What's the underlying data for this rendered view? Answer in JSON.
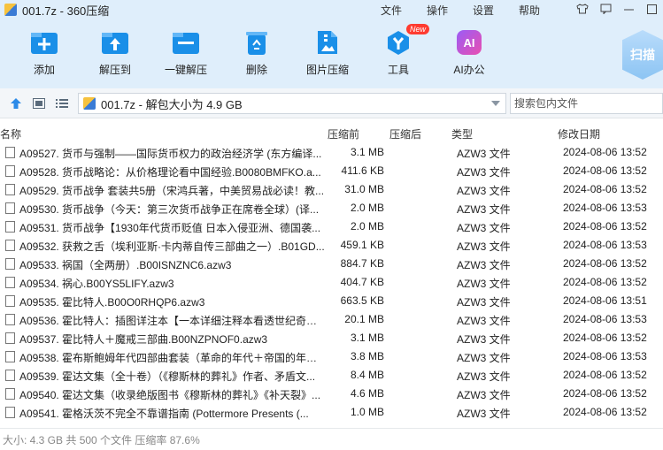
{
  "window": {
    "title": "001.7z - 360压缩"
  },
  "menu": [
    "文件",
    "操作",
    "设置",
    "帮助"
  ],
  "toolbar": {
    "buttons": [
      {
        "label": "添加"
      },
      {
        "label": "解压到"
      },
      {
        "label": "一键解压"
      },
      {
        "label": "删除"
      },
      {
        "label": "图片压缩"
      },
      {
        "label": "工具"
      },
      {
        "label": "AI办公"
      }
    ],
    "new_badge": "New",
    "ai_icon": "AI",
    "scan_label": "扫描"
  },
  "address": {
    "path": "001.7z - 解包大小为 4.9 GB",
    "search_placeholder": "搜索包内文件"
  },
  "columns": {
    "name": "名称",
    "packed": "压缩前",
    "compressed": "压缩后",
    "type": "类型",
    "modified": "修改日期"
  },
  "files": [
    {
      "name": "A09527. 货币与强制——国际货币权力的政治经济学 (东方编译...",
      "size": "3.1 MB",
      "type": "AZW3 文件",
      "date": "2024-08-06 13:52"
    },
    {
      "name": "A09528. 货币战略论：从价格理论看中国经验.B0080BMFKO.a...",
      "size": "411.6 KB",
      "type": "AZW3 文件",
      "date": "2024-08-06 13:52"
    },
    {
      "name": "A09529. 货币战争 套装共5册（宋鸿兵著，中美贸易战必读！教...",
      "size": "31.0 MB",
      "type": "AZW3 文件",
      "date": "2024-08-06 13:52"
    },
    {
      "name": "A09530. 货币战争（今天：第三次货币战争正在席卷全球）(译...",
      "size": "2.0 MB",
      "type": "AZW3 文件",
      "date": "2024-08-06 13:53"
    },
    {
      "name": "A09531. 货币战争【1930年代货币贬值 日本入侵亚洲、德国袭...",
      "size": "2.0 MB",
      "type": "AZW3 文件",
      "date": "2024-08-06 13:52"
    },
    {
      "name": "A09532. 获救之舌（埃利亚斯·卡内蒂自传三部曲之一）.B01GD...",
      "size": "459.1 KB",
      "type": "AZW3 文件",
      "date": "2024-08-06 13:53"
    },
    {
      "name": "A09533. 祸国（全两册）.B00ISNZNC6.azw3",
      "size": "884.7 KB",
      "type": "AZW3 文件",
      "date": "2024-08-06 13:52"
    },
    {
      "name": "A09534. 祸心.B00YS5LIFY.azw3",
      "size": "404.7 KB",
      "type": "AZW3 文件",
      "date": "2024-08-06 13:52"
    },
    {
      "name": "A09535. 霍比特人.B00O0RHQP6.azw3",
      "size": "663.5 KB",
      "type": "AZW3 文件",
      "date": "2024-08-06 13:51"
    },
    {
      "name": "A09536. 霍比特人：插图详注本【一本详细注释本看透世纪奇幻...",
      "size": "20.1 MB",
      "type": "AZW3 文件",
      "date": "2024-08-06 13:53"
    },
    {
      "name": "A09537. 霍比特人＋魔戒三部曲.B00NZPNOF0.azw3",
      "size": "3.1 MB",
      "type": "AZW3 文件",
      "date": "2024-08-06 13:52"
    },
    {
      "name": "A09538. 霍布斯鲍姆年代四部曲套装（革命的年代＋帝国的年代...",
      "size": "3.8 MB",
      "type": "AZW3 文件",
      "date": "2024-08-06 13:53"
    },
    {
      "name": "A09539. 霍达文集（全十卷）（《穆斯林的葬礼》作者、矛盾文...",
      "size": "8.4 MB",
      "type": "AZW3 文件",
      "date": "2024-08-06 13:52"
    },
    {
      "name": "A09540. 霍达文集（收录绝版图书《穆斯林的葬礼》《补天裂》...",
      "size": "4.6 MB",
      "type": "AZW3 文件",
      "date": "2024-08-06 13:52"
    },
    {
      "name": "A09541. 霍格沃茨不完全不靠谱指南 (Pottermore Presents (...",
      "size": "1.0 MB",
      "type": "AZW3 文件",
      "date": "2024-08-06 13:52"
    }
  ],
  "status": "大小: 4.3 GB 共 500 个文件 压缩率 87.6%"
}
